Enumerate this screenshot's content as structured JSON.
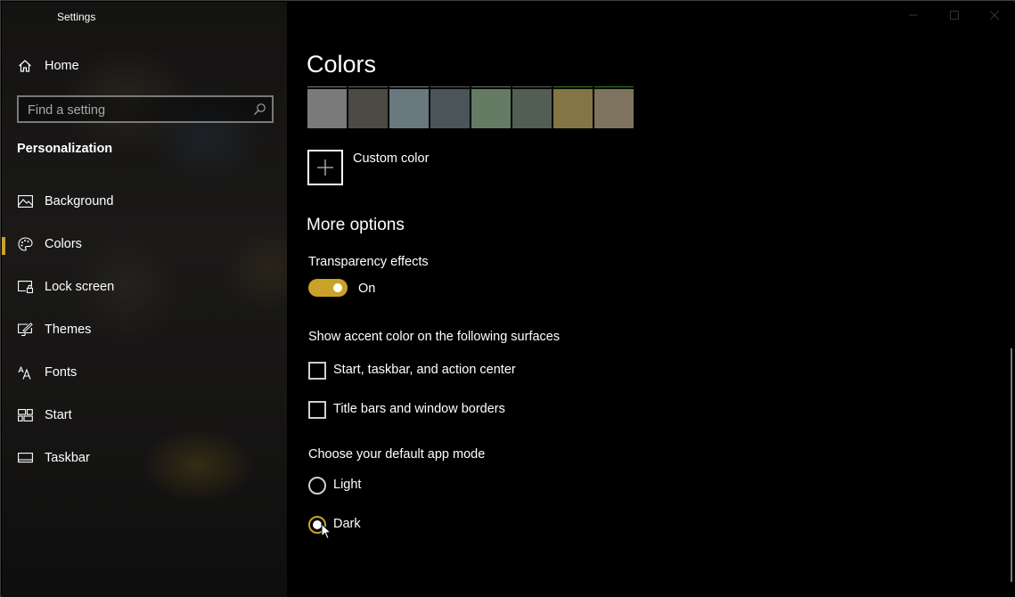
{
  "window": {
    "title": "Settings",
    "controls": {
      "minimize": "minimize-icon",
      "maximize": "maximize-icon",
      "close": "close-icon"
    }
  },
  "sidebar": {
    "home": {
      "label": "Home",
      "icon": "home-icon"
    },
    "search": {
      "placeholder": "Find a setting",
      "value": "",
      "icon": "search-icon"
    },
    "section_title": "Personalization",
    "items": [
      {
        "label": "Background",
        "icon": "picture-icon",
        "selected": false
      },
      {
        "label": "Colors",
        "icon": "palette-icon",
        "selected": true
      },
      {
        "label": "Lock screen",
        "icon": "lock-screen-icon",
        "selected": false
      },
      {
        "label": "Themes",
        "icon": "themes-icon",
        "selected": false
      },
      {
        "label": "Fonts",
        "icon": "fonts-icon",
        "selected": false
      },
      {
        "label": "Start",
        "icon": "start-icon",
        "selected": false
      },
      {
        "label": "Taskbar",
        "icon": "taskbar-icon",
        "selected": false
      }
    ],
    "accent_color": "#c9a227"
  },
  "main": {
    "title": "Colors",
    "swatches": [
      {
        "color": "#7a7a7a",
        "line": "#7a7a7a"
      },
      {
        "color": "#4d4a45",
        "line": "#6a6a6a"
      },
      {
        "color": "#69797e",
        "line": "#7b868a"
      },
      {
        "color": "#4a5459",
        "line": "#5a6064"
      },
      {
        "color": "#647c64",
        "line": "#6e786e"
      },
      {
        "color": "#525e54",
        "line": "#5c625c"
      },
      {
        "color": "#847545",
        "line": "#3a7a1f"
      },
      {
        "color": "#7e735f",
        "line": "#2e7d1f"
      }
    ],
    "custom_color": {
      "label": "Custom color",
      "icon": "plus-icon"
    },
    "more_options": {
      "heading": "More options",
      "transparency": {
        "label": "Transparency effects",
        "state_label": "On",
        "on": true
      },
      "accent_surfaces": {
        "label": "Show accent color on the following surfaces",
        "options": [
          {
            "label": "Start, taskbar, and action center",
            "checked": false
          },
          {
            "label": "Title bars and window borders",
            "checked": false
          }
        ]
      },
      "app_mode": {
        "label": "Choose your default app mode",
        "options": [
          {
            "label": "Light",
            "selected": false
          },
          {
            "label": "Dark",
            "selected": true
          }
        ]
      }
    },
    "accent_color": "#c9a227"
  }
}
